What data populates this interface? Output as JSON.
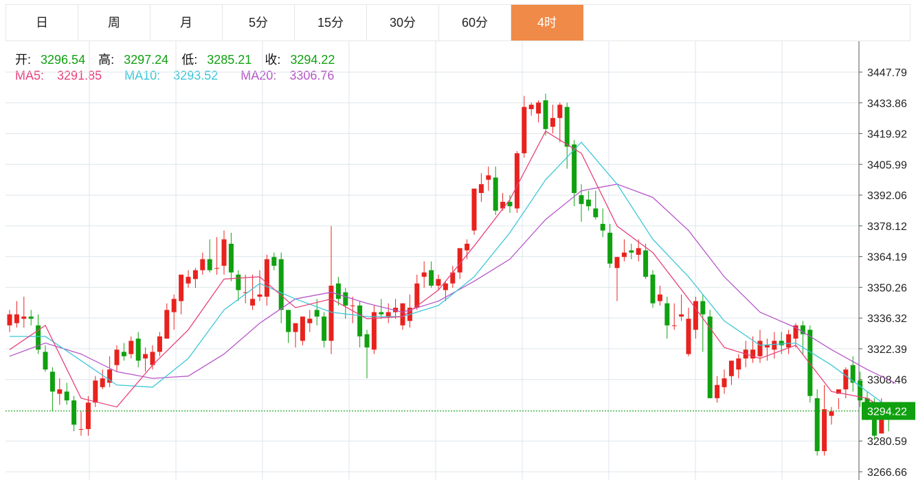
{
  "tabs": [
    {
      "label": "日",
      "active": false
    },
    {
      "label": "周",
      "active": false
    },
    {
      "label": "月",
      "active": false
    },
    {
      "label": "5分",
      "active": false
    },
    {
      "label": "15分",
      "active": false
    },
    {
      "label": "30分",
      "active": false
    },
    {
      "label": "60分",
      "active": false
    },
    {
      "label": "4时",
      "active": true
    }
  ],
  "ohlc_info": {
    "open_label": "开:",
    "open": "3296.54",
    "high_label": "高:",
    "high": "3297.24",
    "low_label": "低:",
    "low": "3285.21",
    "close_label": "收:",
    "close": "3294.22"
  },
  "ma_info": {
    "ma5_label": "MA5:",
    "ma5": "3291.85",
    "ma10_label": "MA10:",
    "ma10": "3293.52",
    "ma20_label": "MA20:",
    "ma20": "3306.76"
  },
  "colors": {
    "up": "#e8221e",
    "down": "#10a010",
    "value_green": "#10a010",
    "ma5": "#e8407a",
    "ma10": "#3cc6d8",
    "ma20": "#b655c8",
    "active_tab": "#f08a48",
    "last_price": "#10a010",
    "grid": "#dde6ec"
  },
  "chart_data": {
    "type": "candlestick",
    "yaxis_ticks": [
      "3447.79",
      "3433.86",
      "3419.92",
      "3405.99",
      "3392.06",
      "3378.12",
      "3364.19",
      "3350.26",
      "3336.32",
      "3322.39",
      "3308.46",
      "3280.59",
      "3266.66"
    ],
    "ylim": [
      3264,
      3457
    ],
    "last_price": "3294.22",
    "candles": [
      [
        3333,
        3340,
        3330,
        3338
      ],
      [
        3334,
        3344,
        3332,
        3338
      ],
      [
        3336,
        3346,
        3332,
        3337
      ],
      [
        3337,
        3340,
        3333,
        3336
      ],
      [
        3333,
        3338,
        3320,
        3322
      ],
      [
        3321,
        3324,
        3312,
        3313
      ],
      [
        3312,
        3314,
        3294,
        3303
      ],
      [
        3302,
        3309,
        3297,
        3304
      ],
      [
        3303,
        3307,
        3297,
        3299
      ],
      [
        3299,
        3301,
        3285,
        3288
      ],
      [
        3286,
        3294,
        3283,
        3286
      ],
      [
        3286,
        3301,
        3283,
        3298
      ],
      [
        3298,
        3310,
        3296,
        3308
      ],
      [
        3305,
        3313,
        3304,
        3309
      ],
      [
        3307,
        3319,
        3305,
        3313
      ],
      [
        3315,
        3324,
        3312,
        3322
      ],
      [
        3321,
        3325,
        3317,
        3319
      ],
      [
        3320,
        3328,
        3318,
        3326
      ],
      [
        3327,
        3330,
        3314,
        3317
      ],
      [
        3318,
        3323,
        3312,
        3320
      ],
      [
        3315,
        3324,
        3313,
        3321
      ],
      [
        3321,
        3330,
        3319,
        3328
      ],
      [
        3327,
        3343,
        3327,
        3340
      ],
      [
        3339,
        3347,
        3331,
        3345
      ],
      [
        3344,
        3355,
        3338,
        3356
      ],
      [
        3352,
        3358,
        3350,
        3355
      ],
      [
        3354,
        3359,
        3350,
        3358
      ],
      [
        3358,
        3366,
        3356,
        3363
      ],
      [
        3363,
        3372,
        3357,
        3358
      ],
      [
        3359,
        3373,
        3356,
        3359
      ],
      [
        3360,
        3376,
        3356,
        3372
      ],
      [
        3370,
        3375,
        3353,
        3357
      ],
      [
        3356,
        3358,
        3344,
        3349
      ],
      [
        3348,
        3356,
        3343,
        3348
      ],
      [
        3342,
        3356,
        3340,
        3345
      ],
      [
        3346,
        3358,
        3344,
        3347
      ],
      [
        3346,
        3365,
        3342,
        3363
      ],
      [
        3364,
        3366,
        3358,
        3360
      ],
      [
        3363,
        3366,
        3334,
        3340
      ],
      [
        3340,
        3340,
        3325,
        3330
      ],
      [
        3330,
        3332,
        3323,
        3334
      ],
      [
        3326,
        3337,
        3324,
        3337
      ],
      [
        3334,
        3340,
        3330,
        3336
      ],
      [
        3340,
        3345,
        3333,
        3337
      ],
      [
        3337,
        3339,
        3323,
        3326
      ],
      [
        3326,
        3378,
        3320,
        3351
      ],
      [
        3352,
        3355,
        3342,
        3345
      ],
      [
        3348,
        3350,
        3336,
        3342
      ],
      [
        3342,
        3346,
        3334,
        3342
      ],
      [
        3342,
        3344,
        3323,
        3328
      ],
      [
        3329,
        3331,
        3309,
        3323
      ],
      [
        3322,
        3342,
        3320,
        3339
      ],
      [
        3339,
        3345,
        3336,
        3338
      ],
      [
        3337,
        3343,
        3334,
        3339
      ],
      [
        3339,
        3345,
        3336,
        3341
      ],
      [
        3333,
        3343,
        3331,
        3343
      ],
      [
        3335,
        3347,
        3332,
        3341
      ],
      [
        3341,
        3356,
        3340,
        3352
      ],
      [
        3355,
        3362,
        3350,
        3357
      ],
      [
        3358,
        3362,
        3350,
        3351
      ],
      [
        3351,
        3356,
        3349,
        3354
      ],
      [
        3349,
        3353,
        3344,
        3352
      ],
      [
        3352,
        3360,
        3350,
        3357
      ],
      [
        3357,
        3367,
        3354,
        3368
      ],
      [
        3367,
        3372,
        3363,
        3370
      ],
      [
        3376,
        3393,
        3374,
        3395
      ],
      [
        3393,
        3402,
        3389,
        3397
      ],
      [
        3399,
        3405,
        3394,
        3401
      ],
      [
        3400,
        3405,
        3383,
        3385
      ],
      [
        3386,
        3393,
        3385,
        3389
      ],
      [
        3389,
        3392,
        3384,
        3387
      ],
      [
        3386,
        3412,
        3384,
        3411
      ],
      [
        3411,
        3437,
        3409,
        3432
      ],
      [
        3431,
        3434,
        3428,
        3433
      ],
      [
        3429,
        3435,
        3425,
        3434
      ],
      [
        3435,
        3438,
        3419,
        3422
      ],
      [
        3423,
        3433,
        3420,
        3427
      ],
      [
        3427,
        3434,
        3416,
        3433
      ],
      [
        3432,
        3434,
        3404,
        3414
      ],
      [
        3415,
        3417,
        3387,
        3393
      ],
      [
        3392,
        3397,
        3380,
        3388
      ],
      [
        3390,
        3394,
        3385,
        3387
      ],
      [
        3386,
        3394,
        3381,
        3382
      ],
      [
        3379,
        3386,
        3373,
        3376
      ],
      [
        3375,
        3379,
        3359,
        3361
      ],
      [
        3359,
        3363,
        3344,
        3364
      ],
      [
        3364,
        3372,
        3362,
        3366
      ],
      [
        3367,
        3370,
        3363,
        3366
      ],
      [
        3365,
        3372,
        3362,
        3368
      ],
      [
        3367,
        3370,
        3354,
        3355
      ],
      [
        3356,
        3358,
        3341,
        3343
      ],
      [
        3344,
        3351,
        3342,
        3347
      ],
      [
        3343,
        3346,
        3327,
        3333
      ],
      [
        3333,
        3343,
        3331,
        3333
      ],
      [
        3337,
        3347,
        3335,
        3338
      ],
      [
        3320,
        3341,
        3319,
        3336
      ],
      [
        3331,
        3346,
        3327,
        3344
      ],
      [
        3344,
        3347,
        3321,
        3338
      ],
      [
        3337,
        3340,
        3300,
        3300
      ],
      [
        3300,
        3310,
        3298,
        3306
      ],
      [
        3305,
        3313,
        3302,
        3309
      ],
      [
        3310,
        3315,
        3306,
        3317
      ],
      [
        3313,
        3320,
        3309,
        3318
      ],
      [
        3318,
        3326,
        3314,
        3322
      ],
      [
        3318,
        3328,
        3316,
        3322
      ],
      [
        3319,
        3331,
        3316,
        3326
      ],
      [
        3323,
        3327,
        3317,
        3324
      ],
      [
        3322,
        3330,
        3318,
        3326
      ],
      [
        3326,
        3330,
        3320,
        3324
      ],
      [
        3323,
        3331,
        3320,
        3329
      ],
      [
        3327,
        3334,
        3323,
        3333
      ],
      [
        3333,
        3335,
        3320,
        3329
      ],
      [
        3331,
        3333,
        3298,
        3301
      ],
      [
        3300,
        3304,
        3274,
        3276
      ],
      [
        3276,
        3306,
        3274,
        3295
      ],
      [
        3292,
        3296,
        3288,
        3294
      ],
      [
        3302,
        3300,
        3295,
        3304
      ],
      [
        3304,
        3314,
        3300,
        3313
      ],
      [
        3315,
        3319,
        3303,
        3307
      ],
      [
        3308,
        3312,
        3296,
        3299
      ],
      [
        3300,
        3303,
        3290,
        3294
      ],
      [
        3294,
        3300,
        3281,
        3283
      ],
      [
        3284,
        3300,
        3284,
        3297
      ],
      [
        3296,
        3297,
        3285,
        3294
      ]
    ],
    "ma5": [
      [
        0,
        3322
      ],
      [
        5,
        3333
      ],
      [
        10,
        3300
      ],
      [
        15,
        3296
      ],
      [
        20,
        3315
      ],
      [
        25,
        3331
      ],
      [
        30,
        3354
      ],
      [
        35,
        3355
      ],
      [
        40,
        3341
      ],
      [
        45,
        3345
      ],
      [
        50,
        3336
      ],
      [
        55,
        3337
      ],
      [
        60,
        3349
      ],
      [
        65,
        3369
      ],
      [
        70,
        3390
      ],
      [
        75,
        3421
      ],
      [
        80,
        3411
      ],
      [
        85,
        3378
      ],
      [
        90,
        3366
      ],
      [
        95,
        3345
      ],
      [
        100,
        3323
      ],
      [
        105,
        3318
      ],
      [
        110,
        3324
      ],
      [
        115,
        3303
      ],
      [
        120,
        3300
      ],
      [
        124,
        3291.85
      ]
    ],
    "ma10": [
      [
        0,
        3328
      ],
      [
        5,
        3328
      ],
      [
        10,
        3317
      ],
      [
        15,
        3306
      ],
      [
        20,
        3305
      ],
      [
        25,
        3318
      ],
      [
        30,
        3340
      ],
      [
        35,
        3352
      ],
      [
        40,
        3345
      ],
      [
        45,
        3339
      ],
      [
        50,
        3337
      ],
      [
        55,
        3337
      ],
      [
        60,
        3342
      ],
      [
        65,
        3355
      ],
      [
        70,
        3375
      ],
      [
        75,
        3399
      ],
      [
        80,
        3416
      ],
      [
        85,
        3397
      ],
      [
        90,
        3372
      ],
      [
        95,
        3355
      ],
      [
        100,
        3335
      ],
      [
        105,
        3324
      ],
      [
        110,
        3325
      ],
      [
        115,
        3315
      ],
      [
        120,
        3303
      ],
      [
        124,
        3293.52
      ]
    ],
    "ma20": [
      [
        0,
        3319
      ],
      [
        5,
        3325
      ],
      [
        10,
        3320
      ],
      [
        15,
        3312
      ],
      [
        20,
        3309
      ],
      [
        25,
        3310
      ],
      [
        30,
        3320
      ],
      [
        35,
        3334
      ],
      [
        40,
        3345
      ],
      [
        45,
        3348
      ],
      [
        50,
        3343
      ],
      [
        55,
        3339
      ],
      [
        60,
        3344
      ],
      [
        65,
        3353
      ],
      [
        70,
        3363
      ],
      [
        75,
        3381
      ],
      [
        80,
        3394
      ],
      [
        85,
        3397
      ],
      [
        90,
        3391
      ],
      [
        95,
        3376
      ],
      [
        100,
        3355
      ],
      [
        105,
        3339
      ],
      [
        110,
        3332
      ],
      [
        115,
        3322
      ],
      [
        120,
        3313
      ],
      [
        124,
        3306.76
      ]
    ]
  }
}
